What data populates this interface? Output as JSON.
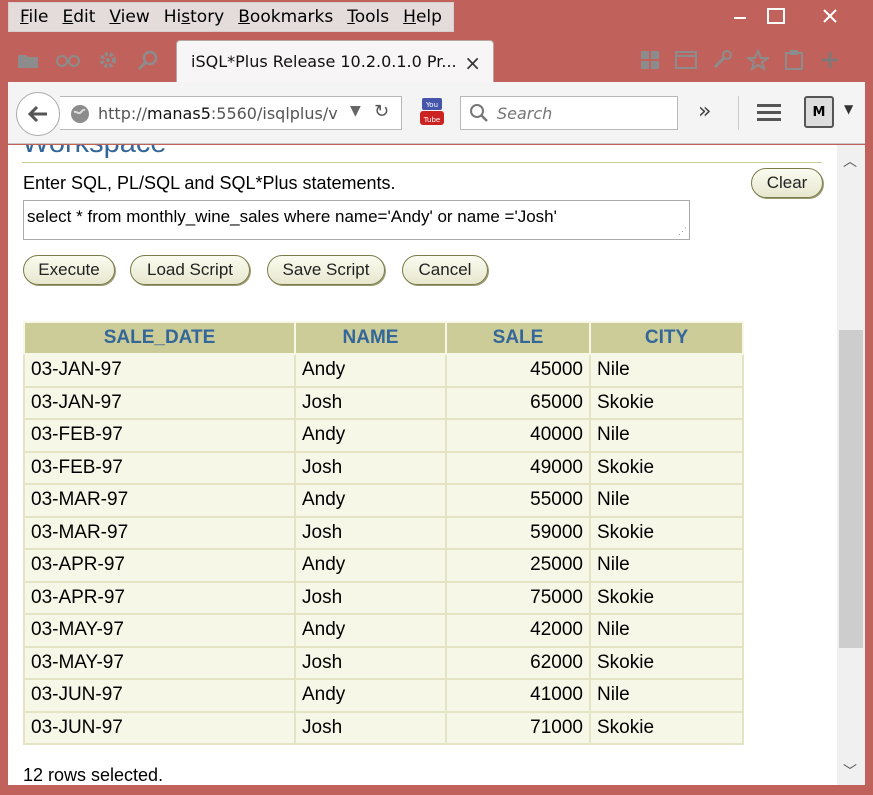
{
  "menu": {
    "items": [
      {
        "label": "File",
        "key": "F",
        "rest": "ile"
      },
      {
        "label": "Edit",
        "key": "E",
        "rest": "dit"
      },
      {
        "label": "View",
        "key": "V",
        "rest": "iew"
      },
      {
        "label": "History",
        "key": "s",
        "pre": "Hi",
        "rest": "tory"
      },
      {
        "label": "Bookmarks",
        "key": "B",
        "rest": "ookmarks"
      },
      {
        "label": "Tools",
        "key": "T",
        "rest": "ools"
      },
      {
        "label": "Help",
        "key": "H",
        "rest": "elp"
      }
    ]
  },
  "tab": {
    "title": "iSQL*Plus Release 10.2.0.1.0 Pr...",
    "close": "×"
  },
  "nav": {
    "url_prefix": "http://",
    "url_host": "manas5",
    "url_rest": ":5560/isqlplus/v",
    "search_placeholder": "Search",
    "overflow": "»"
  },
  "workspace": {
    "title": "Workspace",
    "instructions": "Enter SQL, PL/SQL and SQL*Plus statements.",
    "clear_label": "Clear",
    "sql_text": "select * from monthly_wine_sales where name='Andy' or  name ='Josh'",
    "execute_label": "Execute",
    "load_label": "Load Script",
    "save_label": "Save Script",
    "cancel_label": "Cancel"
  },
  "results": {
    "columns": [
      "SALE_DATE",
      "NAME",
      "SALE",
      "CITY"
    ],
    "rows": [
      [
        "03-JAN-97",
        "Andy",
        "45000",
        "Nile"
      ],
      [
        "03-JAN-97",
        "Josh",
        "65000",
        "Skokie"
      ],
      [
        "03-FEB-97",
        "Andy",
        "40000",
        "Nile"
      ],
      [
        "03-FEB-97",
        "Josh",
        "49000",
        "Skokie"
      ],
      [
        "03-MAR-97",
        "Andy",
        "55000",
        "Nile"
      ],
      [
        "03-MAR-97",
        "Josh",
        "59000",
        "Skokie"
      ],
      [
        "03-APR-97",
        "Andy",
        "25000",
        "Nile"
      ],
      [
        "03-APR-97",
        "Josh",
        "75000",
        "Skokie"
      ],
      [
        "03-MAY-97",
        "Andy",
        "42000",
        "Nile"
      ],
      [
        "03-MAY-97",
        "Josh",
        "62000",
        "Skokie"
      ],
      [
        "03-JUN-97",
        "Andy",
        "41000",
        "Nile"
      ],
      [
        "03-JUN-97",
        "Josh",
        "71000",
        "Skokie"
      ]
    ],
    "status": "12 rows selected."
  },
  "colors": {
    "window_frame": "#c0625b",
    "header_bg": "#cccc99",
    "header_text": "#336699",
    "row_bg": "#f7f7e7"
  }
}
